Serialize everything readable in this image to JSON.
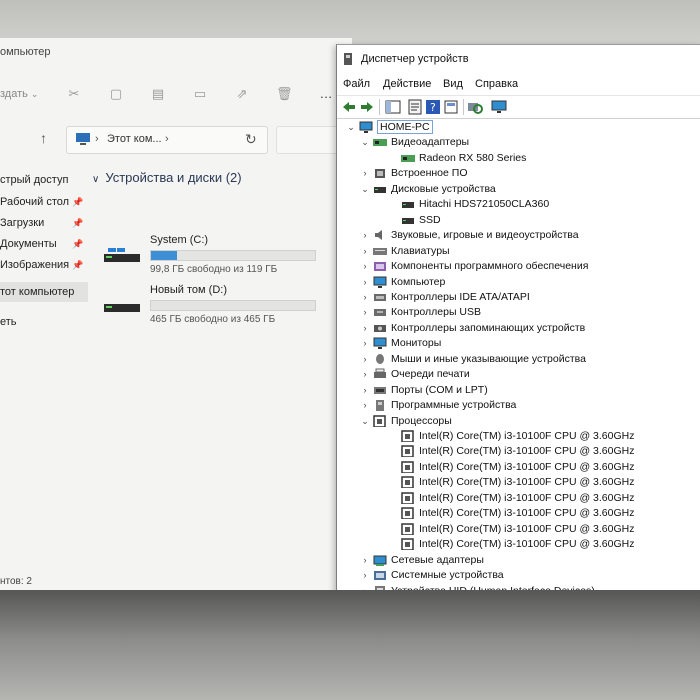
{
  "explorer": {
    "title": "омпьютер",
    "create_label": "здать",
    "address": {
      "path": "Этот ком...",
      "sep": "›"
    },
    "sidebar": [
      {
        "label": "стрый доступ",
        "pin": false,
        "active": false
      },
      {
        "label": "Рабочий стол",
        "pin": true,
        "active": false
      },
      {
        "label": "Загрузки",
        "pin": true,
        "active": false
      },
      {
        "label": "Документы",
        "pin": true,
        "active": false
      },
      {
        "label": "Изображения",
        "pin": true,
        "active": false
      },
      {
        "label": "тот компьютер",
        "pin": false,
        "active": true
      },
      {
        "label": "еть",
        "pin": false,
        "active": false
      }
    ],
    "group_label": "Устройства и диски (2)",
    "drives": [
      {
        "name": "System (C:)",
        "free": "99,8 ГБ свободно из 119 ГБ",
        "used_fraction": 0.16,
        "icon": "windows-drive-icon"
      },
      {
        "name": "Новый том (D:)",
        "free": "465 ГБ свободно из 465 ГБ",
        "used_fraction": 0.0,
        "icon": "drive-icon"
      }
    ],
    "status": "нтов: 2"
  },
  "devmgr": {
    "title": "Диспетчер устройств",
    "menu": [
      "Файл",
      "Действие",
      "Вид",
      "Справка"
    ],
    "tree": [
      {
        "text": "HOME-PC",
        "level": 0,
        "expander": "v",
        "icon": "computer-icon",
        "root": true
      },
      {
        "text": "Видеоадаптеры",
        "level": 1,
        "expander": "v",
        "icon": "display-adapter-icon"
      },
      {
        "text": "Radeon RX 580 Series",
        "level": 2,
        "expander": "",
        "icon": "display-adapter-icon"
      },
      {
        "text": "Встроенное ПО",
        "level": 1,
        "expander": ">",
        "icon": "firmware-icon"
      },
      {
        "text": "Дисковые устройства",
        "level": 1,
        "expander": "v",
        "icon": "disk-icon"
      },
      {
        "text": "Hitachi HDS721050CLA360",
        "level": 2,
        "expander": "",
        "icon": "disk-icon"
      },
      {
        "text": "SSD",
        "level": 2,
        "expander": "",
        "icon": "disk-icon"
      },
      {
        "text": "Звуковые, игровые и видеоустройства",
        "level": 1,
        "expander": ">",
        "icon": "sound-icon"
      },
      {
        "text": "Клавиатуры",
        "level": 1,
        "expander": ">",
        "icon": "keyboard-icon"
      },
      {
        "text": "Компоненты программного обеспечения",
        "level": 1,
        "expander": ">",
        "icon": "software-component-icon"
      },
      {
        "text": "Компьютер",
        "level": 1,
        "expander": ">",
        "icon": "monitor-icon"
      },
      {
        "text": "Контроллеры IDE ATA/ATAPI",
        "level": 1,
        "expander": ">",
        "icon": "ide-controller-icon"
      },
      {
        "text": "Контроллеры USB",
        "level": 1,
        "expander": ">",
        "icon": "usb-icon"
      },
      {
        "text": "Контроллеры запоминающих устройств",
        "level": 1,
        "expander": ">",
        "icon": "storage-controller-icon"
      },
      {
        "text": "Мониторы",
        "level": 1,
        "expander": ">",
        "icon": "monitor-icon"
      },
      {
        "text": "Мыши и иные указывающие устройства",
        "level": 1,
        "expander": ">",
        "icon": "mouse-icon"
      },
      {
        "text": "Очереди печати",
        "level": 1,
        "expander": ">",
        "icon": "printer-icon"
      },
      {
        "text": "Порты (COM и LPT)",
        "level": 1,
        "expander": ">",
        "icon": "port-icon"
      },
      {
        "text": "Программные устройства",
        "level": 1,
        "expander": ">",
        "icon": "software-device-icon"
      },
      {
        "text": "Процессоры",
        "level": 1,
        "expander": "v",
        "icon": "processor-icon"
      },
      {
        "text": "Intel(R) Core(TM) i3-10100F CPU @ 3.60GHz",
        "level": 2,
        "expander": "",
        "icon": "processor-icon"
      },
      {
        "text": "Intel(R) Core(TM) i3-10100F CPU @ 3.60GHz",
        "level": 2,
        "expander": "",
        "icon": "processor-icon"
      },
      {
        "text": "Intel(R) Core(TM) i3-10100F CPU @ 3.60GHz",
        "level": 2,
        "expander": "",
        "icon": "processor-icon"
      },
      {
        "text": "Intel(R) Core(TM) i3-10100F CPU @ 3.60GHz",
        "level": 2,
        "expander": "",
        "icon": "processor-icon"
      },
      {
        "text": "Intel(R) Core(TM) i3-10100F CPU @ 3.60GHz",
        "level": 2,
        "expander": "",
        "icon": "processor-icon"
      },
      {
        "text": "Intel(R) Core(TM) i3-10100F CPU @ 3.60GHz",
        "level": 2,
        "expander": "",
        "icon": "processor-icon"
      },
      {
        "text": "Intel(R) Core(TM) i3-10100F CPU @ 3.60GHz",
        "level": 2,
        "expander": "",
        "icon": "processor-icon"
      },
      {
        "text": "Intel(R) Core(TM) i3-10100F CPU @ 3.60GHz",
        "level": 2,
        "expander": "",
        "icon": "processor-icon"
      },
      {
        "text": "Сетевые адаптеры",
        "level": 1,
        "expander": ">",
        "icon": "network-adapter-icon"
      },
      {
        "text": "Системные устройства",
        "level": 1,
        "expander": ">",
        "icon": "system-device-icon"
      },
      {
        "text": "Устройства HID (Human Interface Devices)",
        "level": 1,
        "expander": ">",
        "icon": "hid-icon"
      }
    ]
  },
  "colors": {
    "accent": "#3d8fd6",
    "root_box": "#7ba2d6"
  }
}
